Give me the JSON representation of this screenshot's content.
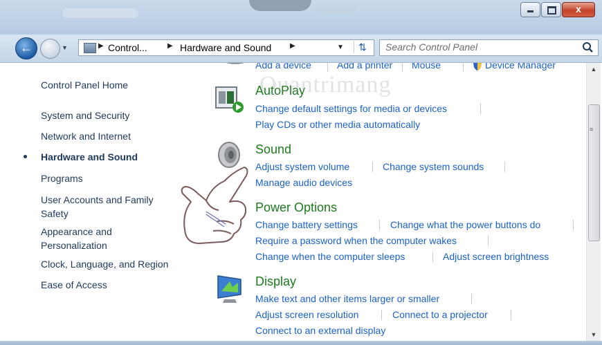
{
  "window": {
    "buttons": {
      "minimize_icon": "minimize-icon",
      "maximize_icon": "maximize-icon",
      "close_label": "x"
    }
  },
  "nav": {
    "back_icon": "back-arrow-icon",
    "forward_icon": "forward-arrow-icon",
    "breadcrumb": [
      "Control...",
      "Hardware and Sound"
    ],
    "search_placeholder": "Search Control Panel"
  },
  "sidebar": {
    "items": [
      {
        "label": "Control Panel Home"
      },
      {
        "label": "System and Security"
      },
      {
        "label": "Network and Internet"
      },
      {
        "label": "Hardware and Sound",
        "active": true
      },
      {
        "label": "Programs"
      },
      {
        "label": "User Accounts and Family Safety"
      },
      {
        "label": "Appearance and Personalization"
      },
      {
        "label": "Clock, Language, and Region"
      },
      {
        "label": "Ease of Access"
      }
    ]
  },
  "main": {
    "devices_partial": [
      "Add a device",
      "Add a printer",
      "Mouse",
      "Device Manager"
    ],
    "autoplay": {
      "title": "AutoPlay",
      "links": [
        "Change default settings for media or devices",
        "Play CDs or other media automatically"
      ]
    },
    "sound": {
      "title": "Sound",
      "links": [
        "Adjust system volume",
        "Change system sounds",
        "Manage audio devices"
      ]
    },
    "power": {
      "title": "Power Options",
      "links": [
        "Change battery settings",
        "Change what the power buttons do",
        "Require a password when the computer wakes",
        "Change when the computer sleeps",
        "Adjust screen brightness"
      ]
    },
    "display": {
      "title": "Display",
      "links": [
        "Make text and other items larger or smaller",
        "Adjust screen resolution",
        "Connect to a projector",
        "Connect to an external display"
      ]
    }
  },
  "watermark": "Quantrimang",
  "colors": {
    "link": "#1a61c9",
    "category_title": "#1e7a1e",
    "sidebar_text": "#1e395b"
  }
}
